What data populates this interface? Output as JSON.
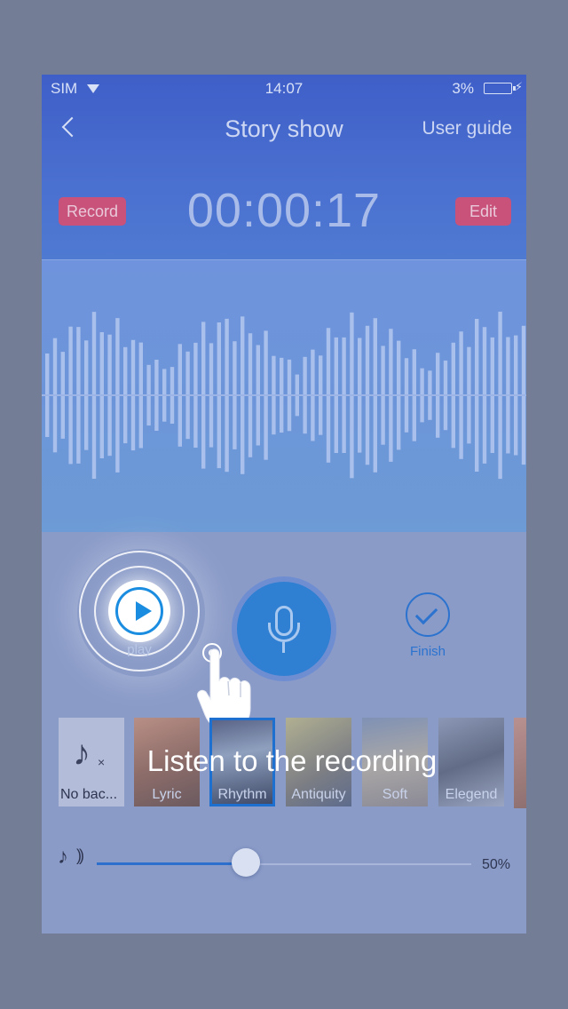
{
  "status_bar": {
    "carrier": "SIM",
    "time": "14:07",
    "battery": "3%"
  },
  "nav": {
    "title": "Story show",
    "user_guide": "User guide"
  },
  "recorder": {
    "record_label": "Record",
    "timer": "00:00:17",
    "edit_label": "Edit"
  },
  "controls": {
    "play_label": "play",
    "finish_label": "Finish"
  },
  "overlay_caption": "Listen to the recording",
  "music": {
    "items": [
      {
        "label": "No bac...",
        "selected": false,
        "icon": "music-note-off-icon"
      },
      {
        "label": "Lyric",
        "selected": false
      },
      {
        "label": "Rhythm",
        "selected": true
      },
      {
        "label": "Antiquity",
        "selected": false
      },
      {
        "label": "Soft",
        "selected": false
      },
      {
        "label": "Elegend",
        "selected": false
      }
    ]
  },
  "volume": {
    "value_label": "50%",
    "level": 0.5
  },
  "colors": {
    "accent": "#1a8de0",
    "mic_button": "#2f7fd2",
    "record_button": "#c8527a",
    "header": "#3f5fc8"
  }
}
